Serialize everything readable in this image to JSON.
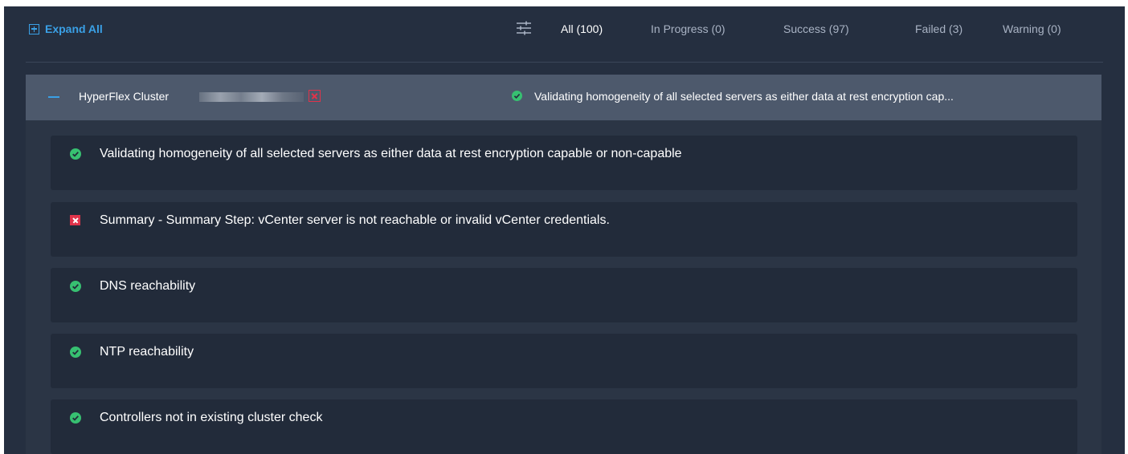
{
  "toolbar": {
    "expand_all_label": "Expand All",
    "filter_icon": "filter-sliders-icon",
    "tabs": [
      {
        "label": "All (100)",
        "active": true
      },
      {
        "label": "In Progress (0)",
        "active": false
      },
      {
        "label": "Success (97)",
        "active": false
      },
      {
        "label": "Failed (3)",
        "active": false
      },
      {
        "label": "Warning (0)",
        "active": false
      }
    ]
  },
  "cluster": {
    "name": "HyperFlex Cluster",
    "collapse_icon": "minus-icon",
    "fail_icon": "failed-x-icon",
    "status_icon": "success-check-icon",
    "status_text": "Validating homogeneity of all selected servers as either data at rest encryption cap..."
  },
  "steps": [
    {
      "status": "success",
      "icon": "success-check-icon",
      "text": "Validating homogeneity of all selected servers as either data at rest encryption capable or non-capable"
    },
    {
      "status": "failed",
      "icon": "failed-x-icon",
      "text": "Summary - Summary Step: vCenter server is not reachable or invalid vCenter credentials."
    },
    {
      "status": "success",
      "icon": "success-check-icon",
      "text": "DNS reachability"
    },
    {
      "status": "success",
      "icon": "success-check-icon",
      "text": "NTP reachability"
    },
    {
      "status": "success",
      "icon": "success-check-icon",
      "text": "Controllers not in existing cluster check"
    }
  ],
  "colors": {
    "background": "#252f40",
    "accent": "#3aa0e6",
    "success": "#37c071",
    "failed": "#e0334a",
    "cluster_header": "#4d596c",
    "step_card": "#222b3a"
  }
}
